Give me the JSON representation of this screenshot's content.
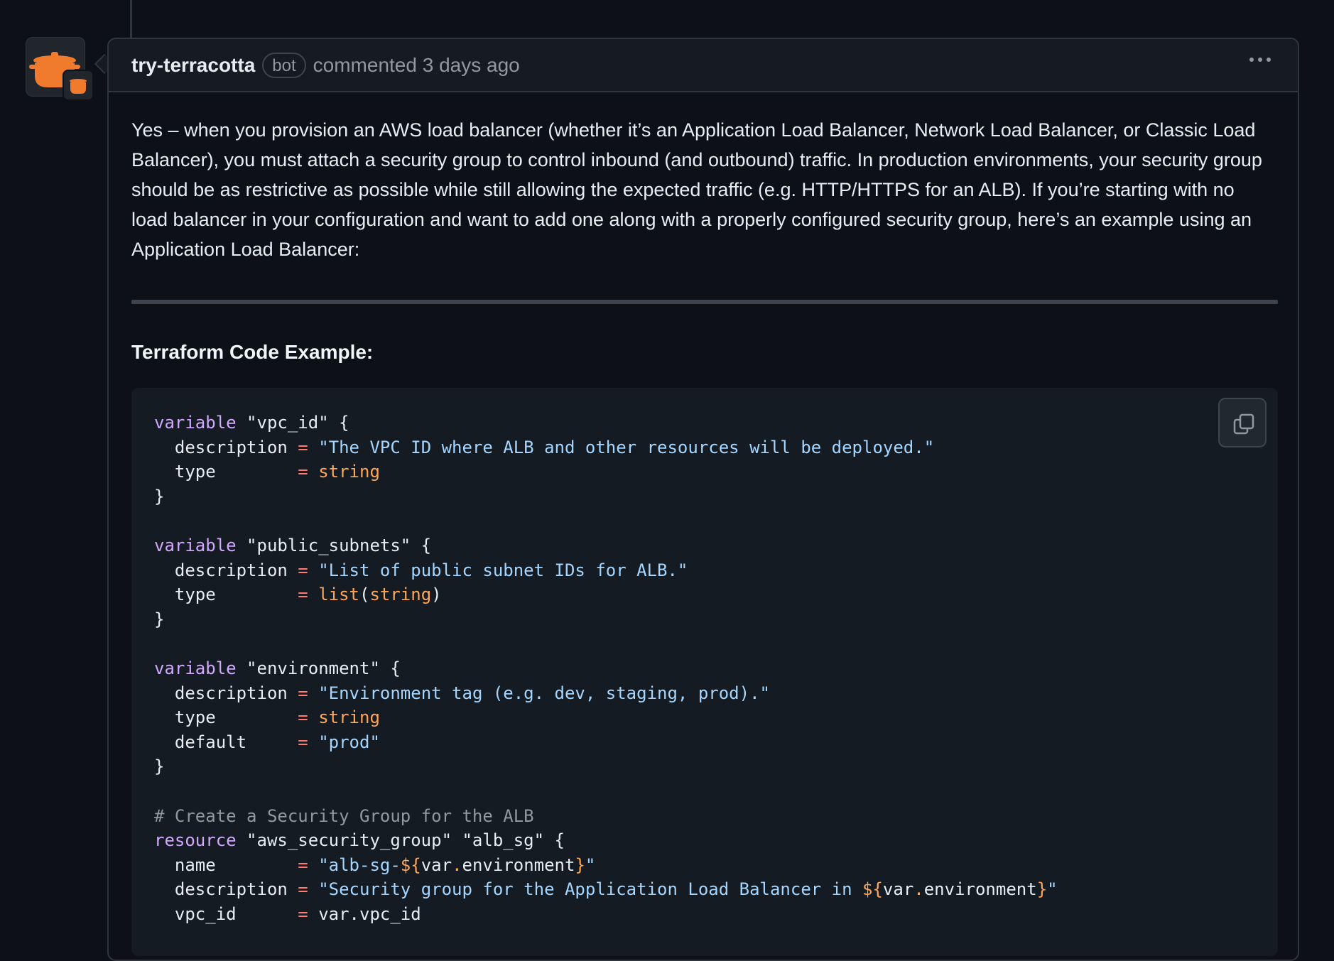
{
  "comment": {
    "author": "try-terracotta",
    "badge": "bot",
    "meta": "commented 3 days ago",
    "avatar_icon": "terracotta-pot-icon",
    "menu_icon": "kebab-horizontal-icon",
    "body_paragraph": "Yes – when you provision an AWS load balancer (whether it’s an Application Load Balancer, Network Load Balancer, or Classic Load Balancer), you must attach a security group to control inbound (and outbound) traffic. In production environments, your security group should be as restrictive as possible while still allowing the expected traffic (e.g. HTTP/HTTPS for an ALB). If you’re starting with no load balancer in your configuration and want to add one along with a properly configured security group, here’s an example using an Application Load Balancer:",
    "section_heading": "Terraform Code Example:",
    "copy_icon": "copy-icon"
  },
  "code": [
    [
      [
        "kw",
        "variable"
      ],
      [
        "",
        "\"vpc_id\" {"
      ]
    ],
    [
      [
        "",
        "  description "
      ],
      [
        "op",
        "="
      ],
      [
        "str",
        " \"The VPC ID where ALB and other resources will be deployed.\""
      ]
    ],
    [
      [
        "",
        "  type        "
      ],
      [
        "op",
        "="
      ],
      [
        "typ",
        " string"
      ]
    ],
    [
      [
        "",
        "}"
      ]
    ],
    [
      [
        "",
        ""
      ]
    ],
    [
      [
        "kw",
        "variable"
      ],
      [
        "",
        "\"public_subnets\" {"
      ]
    ],
    [
      [
        "",
        "  description "
      ],
      [
        "op",
        "="
      ],
      [
        "str",
        " \"List of public subnet IDs for ALB.\""
      ]
    ],
    [
      [
        "",
        "  type        "
      ],
      [
        "op",
        "="
      ],
      [
        "typ",
        " list"
      ],
      [
        "",
        "("
      ],
      [
        "typ",
        "string"
      ],
      [
        "",
        ")"
      ]
    ],
    [
      [
        "",
        "}"
      ]
    ],
    [
      [
        "",
        ""
      ]
    ],
    [
      [
        "kw",
        "variable"
      ],
      [
        "",
        "\"environment\" {"
      ]
    ],
    [
      [
        "",
        "  description "
      ],
      [
        "op",
        "="
      ],
      [
        "str",
        " \"Environment tag (e.g. dev, staging, prod).\""
      ]
    ],
    [
      [
        "",
        "  type        "
      ],
      [
        "op",
        "="
      ],
      [
        "typ",
        " string"
      ]
    ],
    [
      [
        "",
        "  default     "
      ],
      [
        "op",
        "="
      ],
      [
        "str",
        " \"prod\""
      ]
    ],
    [
      [
        "",
        "}"
      ]
    ],
    [
      [
        "",
        ""
      ]
    ],
    [
      [
        "cm",
        "# Create a Security Group for the ALB"
      ]
    ],
    [
      [
        "kw",
        "resource"
      ],
      [
        "",
        "\"aws_security_group\" \"alb_sg\" {"
      ]
    ],
    [
      [
        "",
        "  name        "
      ],
      [
        "op",
        "="
      ],
      [
        "str",
        " \"alb-sg-"
      ],
      [
        "typ",
        "${"
      ],
      [
        "",
        "var"
      ],
      [
        "typ",
        "."
      ],
      [
        "",
        "environment"
      ],
      [
        "typ",
        "}"
      ],
      [
        "str",
        "\""
      ]
    ],
    [
      [
        "",
        "  description "
      ],
      [
        "op",
        "="
      ],
      [
        "str",
        " \"Security group for the Application Load Balancer in "
      ],
      [
        "typ",
        "${"
      ],
      [
        "",
        "var"
      ],
      [
        "typ",
        "."
      ],
      [
        "",
        "environment"
      ],
      [
        "typ",
        "}"
      ],
      [
        "str",
        "\""
      ]
    ],
    [
      [
        "",
        "  vpc_id      "
      ],
      [
        "op",
        "="
      ],
      [
        "",
        " var.vpc_id"
      ]
    ]
  ]
}
